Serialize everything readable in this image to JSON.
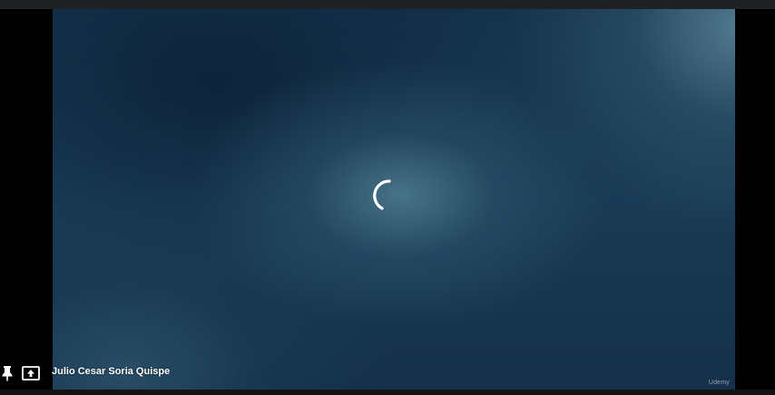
{
  "tile": {
    "participant_name": "Julio Cesar Soria Quispe",
    "watermark": "Udemy",
    "loading_state": "loading"
  },
  "icons": {
    "pin": "pin-icon",
    "present": "present-to-all-icon",
    "spinner": "loading-spinner-icon"
  },
  "colors": {
    "video_background": "#1a3b55",
    "spinner": "#ffffff",
    "top_bar": "#202124",
    "letterbox": "#000000",
    "name_text": "#ffffff"
  }
}
